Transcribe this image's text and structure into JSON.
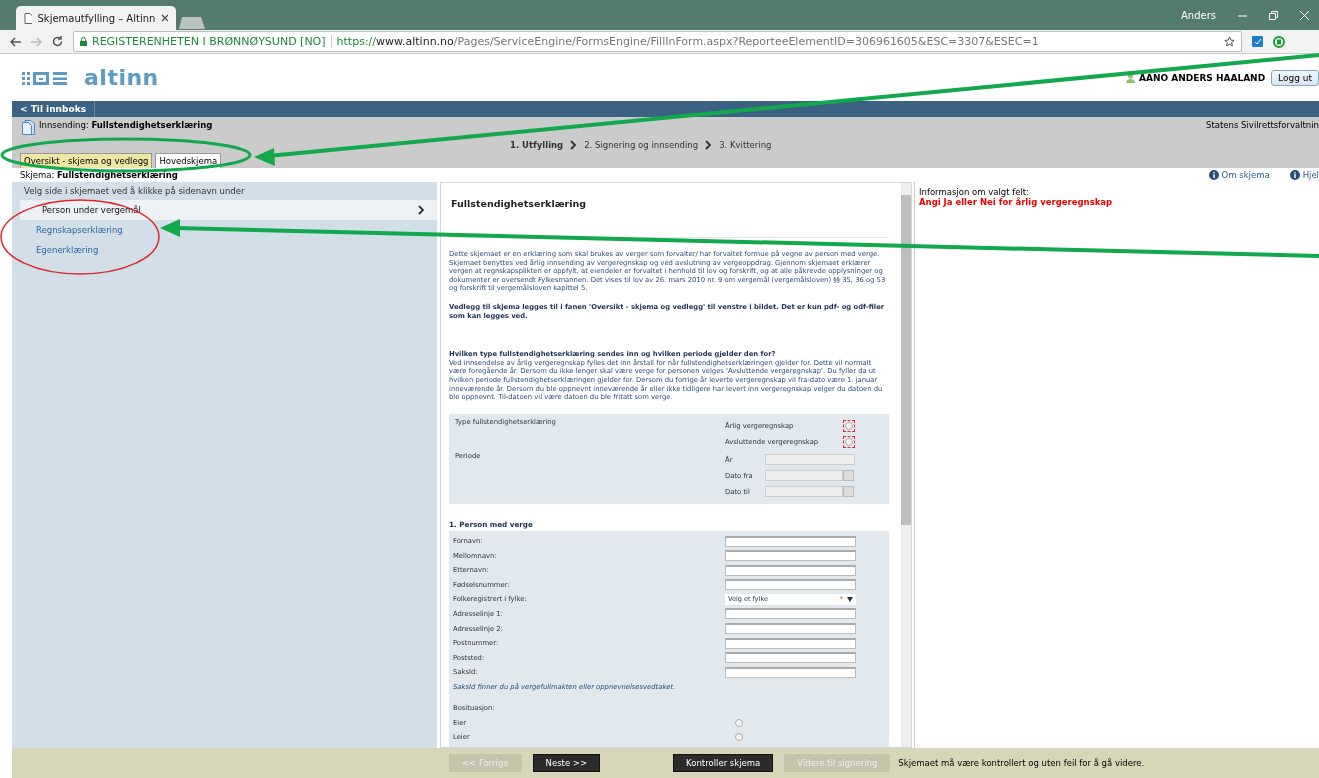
{
  "browser": {
    "tab_title": "Skjemautfylling – Altinn",
    "profile": "Anders",
    "security_label": "REGISTERENHETEN I BRØNNØYSUND [NO]",
    "url_scheme": "https://",
    "url_host": "www.altinn.no",
    "url_path": "/Pages/ServiceEngine/FormsEngine/FillInForm.aspx?ReporteeElementID=306961605&ESC=3307&ESEC=1"
  },
  "header": {
    "logo_text": "altinn",
    "user_name": "AANO ANDERS HAALAND",
    "logout": "Logg ut"
  },
  "nav": {
    "back_link": "< Til innboks"
  },
  "submission": {
    "title": "Innsending: **Fullstendighetserklæring**",
    "agency": "Statens Sivilrettsforvaltnin",
    "steps": [
      {
        "label": "1. Utfylling",
        "selected": true
      },
      {
        "label": "2. Signering og innsending",
        "selected": false
      },
      {
        "label": "3. Kvittering",
        "selected": false
      }
    ]
  },
  "tabs": [
    {
      "label": "Oversikt - skjema og vedlegg",
      "selected": false
    },
    {
      "label": "Hovedskjema",
      "selected": true
    }
  ],
  "schema": {
    "title": "Skjema: **Fullstendighetserklæring**",
    "links": [
      "Om skjema",
      "Hjel"
    ]
  },
  "sidebar": {
    "hint": "Velg side i skjemaet ved å klikke på sidenavn under",
    "items": [
      {
        "label": "Person under vergemål",
        "selected": true
      },
      {
        "label": "Regnskapserklæring",
        "selected": false
      },
      {
        "label": "Egenerklæring",
        "selected": false
      }
    ]
  },
  "form": {
    "title": "Fullstendighetserklæring",
    "intro": "Dette skjemaet er en erklæring som skal brukes av verger som forvalter/ har forvaltet formue på vegne av person med verge. Skjemaet benyttes ved årlig innsending av vergeregnskap og ved avslutning av vergeoppdrag. Gjennom skjemaet erklærer vergen at regnskapsplikten er oppfylt, at eiendeler er forvaltet i henhold til lov og forskrift, og at alle påkrevde opplysninger og dokumenter er oversendt Fylkesmannen. Det vises til lov av 26. mars 2010 nr. 9 om vergemål (vergemålsloven) §§ 35, 36 og 53 og forskrift til vergemålsloven kapittel 5.",
    "attachment_note": "Vedlegg til skjema legges til i fanen 'Oversikt - skjema og vedlegg' til venstre i bildet. Det er kun pdf- og odf-filer som kan legges ved.",
    "question": "Hvilken type fullstendighetserklæring sendes inn og hvilken periode gjelder den for?",
    "question_text": "Ved innsendelse av årlig vergeregnskap fylles det inn årstall for når fullstendighetserklæringen gjelder for. Dette vil normalt være foregående år. Dersom du ikke lenger skal være verge for personen velges 'Avsluttende vergeregnskap'. Du fyller da ut hvilken periode fullstendighetserklæringen gjelder for. Dersom du forrige år leverte vergeregnskap vil fra-dato være 1. januar inneværende år. Dersom du ble oppnevnt inneværende år eller ikke tidligere har levert inn vergeregnskap velger du datoen du ble oppnevnt. Til-datoen vil være datoen du ble fritatt som verge.",
    "type_label": "Type fullstendighetserklæring",
    "type_options": [
      {
        "label": "Årlig vergeregnskap",
        "checked": false
      },
      {
        "label": "Avsluttende vergeregnskap",
        "checked": false
      }
    ],
    "period_label": "Periode",
    "period_fields": [
      {
        "label": "År",
        "kind": "text"
      },
      {
        "label": "Dato fra",
        "kind": "date"
      },
      {
        "label": "Dato til",
        "kind": "date"
      }
    ],
    "section_title": "1. Person med verge",
    "fields": [
      {
        "label": "Fornavn:",
        "kind": "text"
      },
      {
        "label": "Mellomnavn:",
        "kind": "text"
      },
      {
        "label": "Etternavn:",
        "kind": "text"
      },
      {
        "label": "Fødselsnummer:",
        "kind": "text"
      },
      {
        "label": "Folkeregistrert i fylke:",
        "kind": "select",
        "placeholder": "Velg et fylke",
        "required_mark": "*"
      },
      {
        "label": "Adresselinje 1:",
        "kind": "text"
      },
      {
        "label": "Adresselinje 2:",
        "kind": "text"
      },
      {
        "label": "Postnummer:",
        "kind": "text"
      },
      {
        "label": "Poststed:",
        "kind": "text"
      },
      {
        "label": "SaksId:",
        "kind": "text"
      }
    ],
    "saksid_hint": "SaksId finner du på vergefullmakten eller oppnevnelsesvedtaket.",
    "situation_label": "Bosituasjon:",
    "situation_options": [
      {
        "label": "Eier",
        "selected": false
      },
      {
        "label": "Leier",
        "selected": false
      }
    ]
  },
  "info": {
    "title": "Informasjon om valgt felt:",
    "message": "Angi Ja eller Nei for årlig vergeregnskap"
  },
  "footer": {
    "buttons": [
      {
        "label": "<< Forrige",
        "disabled": true
      },
      {
        "label": "Neste >>",
        "disabled": false
      },
      {
        "label": "Kontroller skjema",
        "disabled": false
      },
      {
        "label": "Videre til signering",
        "disabled": true
      }
    ],
    "note": "Skjemaet må være kontrollert og uten feil for å gå videre."
  }
}
